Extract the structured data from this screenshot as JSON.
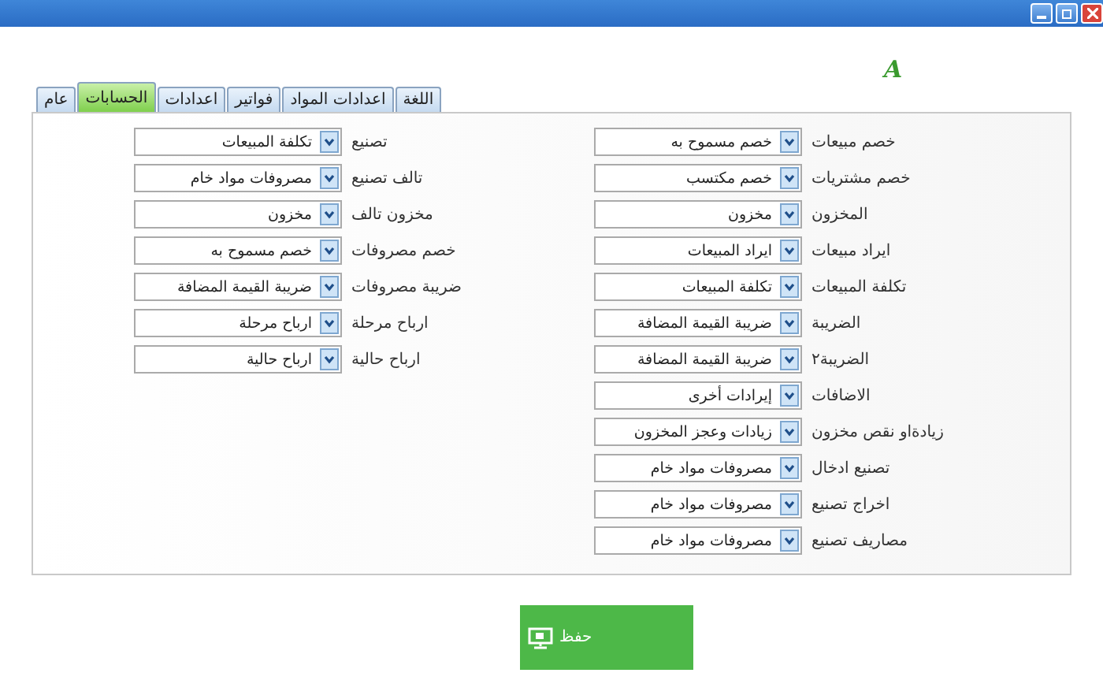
{
  "window": {
    "logo": "A"
  },
  "tabs": [
    {
      "label": "اللغة",
      "selected": false
    },
    {
      "label": "اعدادات المواد",
      "selected": false
    },
    {
      "label": "فواتير",
      "selected": false
    },
    {
      "label": "اعدادات",
      "selected": false
    },
    {
      "label": "الحسابات",
      "selected": true
    },
    {
      "label": "عام",
      "selected": false
    }
  ],
  "right_fields": [
    {
      "label": "خصم مبيعات",
      "value": "خصم مسموح به"
    },
    {
      "label": "خصم مشتريات",
      "value": "خصم مكتسب"
    },
    {
      "label": "المخزون",
      "value": "مخزون"
    },
    {
      "label": "ايراد مبيعات",
      "value": "ايراد المبيعات"
    },
    {
      "label": "تكلفة المبيعات",
      "value": "تكلفة المبيعات"
    },
    {
      "label": "الضريبة",
      "value": "ضريبة القيمة المضافة"
    },
    {
      "label": "الضريبة٢",
      "value": "ضريبة القيمة المضافة"
    },
    {
      "label": "الاضافات",
      "value": "إيرادات أخرى"
    },
    {
      "label": "زيادةاو نقص مخزون",
      "value": "زيادات وعجز المخزون"
    },
    {
      "label": "تصنيع ادخال",
      "value": "مصروفات مواد خام"
    },
    {
      "label": "اخراج تصنيع",
      "value": "مصروفات مواد خام"
    },
    {
      "label": "مصاريف تصنيع",
      "value": "مصروفات مواد خام"
    }
  ],
  "left_fields": [
    {
      "label": "تصنيع",
      "value": "تكلفة المبيعات"
    },
    {
      "label": "تالف تصنيع",
      "value": "مصروفات مواد خام"
    },
    {
      "label": "مخزون تالف",
      "value": "مخزون"
    },
    {
      "label": "خصم مصروفات",
      "value": "خصم مسموح به"
    },
    {
      "label": "ضريبة مصروفات",
      "value": "ضريبة القيمة المضافة"
    },
    {
      "label": "ارباح مرحلة",
      "value": "ارباح مرحلة"
    },
    {
      "label": "ارباح حالية",
      "value": "ارباح حالية"
    }
  ],
  "save_button": {
    "label": "حفظ"
  }
}
